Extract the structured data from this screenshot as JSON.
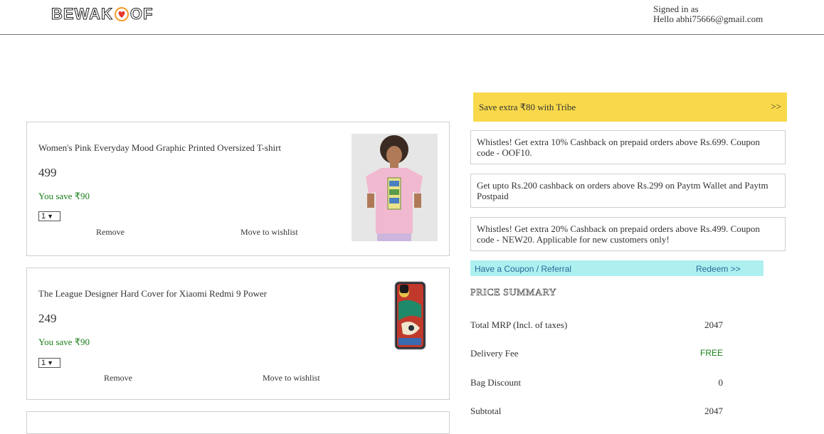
{
  "header": {
    "logo_text": "BEWAKOOF",
    "signed_in_label": "Signed in as",
    "signed_in_user": "Hello abhi75666@gmail.com"
  },
  "cart": {
    "items": [
      {
        "name": "Women's Pink Everyday Mood Graphic Printed Oversized T-shirt",
        "price": "499",
        "you_save": "You save ₹90",
        "qty": "1",
        "remove_label": "Remove",
        "wishlist_label": "Move to wishlist"
      },
      {
        "name": "The League Designer Hard Cover for Xiaomi Redmi 9 Power",
        "price": "249",
        "you_save": "You save ₹90",
        "qty": "1",
        "remove_label": "Remove",
        "wishlist_label": "Move to wishlist"
      }
    ]
  },
  "tribe": {
    "text": "Save extra ₹80 with Tribe",
    "arrow": ">>"
  },
  "offers": [
    "Whistles! Get extra 10% Cashback on prepaid orders above Rs.699. Coupon code - OOF10.",
    "Get upto Rs.200 cashback on orders above Rs.299 on Paytm Wallet and Paytm Postpaid",
    "Whistles! Get extra 20% Cashback on prepaid orders above Rs.499. Coupon code - NEW20. Applicable for new customers only!"
  ],
  "coupon": {
    "label": "Have a Coupon / Referral",
    "action": "Redeem >>"
  },
  "price_summary": {
    "title": "PRICE SUMMARY",
    "rows": [
      {
        "label": "Total MRP (Incl. of taxes)",
        "value": "2047"
      },
      {
        "label": "Delivery Fee",
        "value": "FREE"
      },
      {
        "label": "Bag Discount",
        "value": "0"
      },
      {
        "label": "Subtotal",
        "value": "2047"
      }
    ]
  },
  "colors": {
    "tribe_bg": "#f9d94b",
    "coupon_bg": "#aef0f0",
    "save_green": "#1a7f1a"
  }
}
